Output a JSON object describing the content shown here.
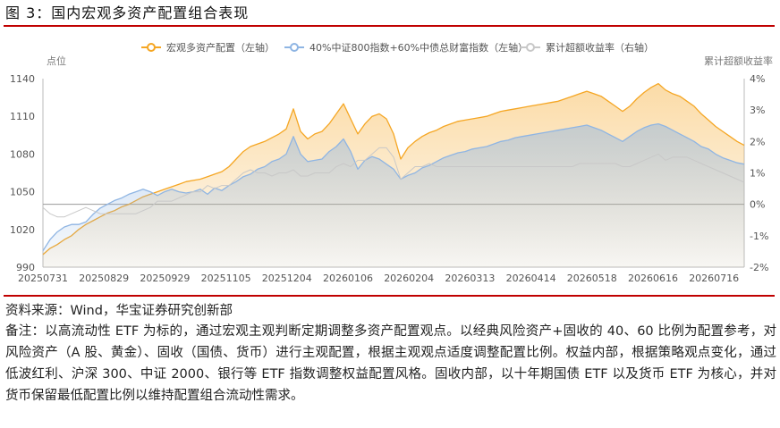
{
  "figure": {
    "title": "图 3：国内宏观多资产配置组合表现",
    "source": "资料来源：Wind，华宝证券研究创新部",
    "note": "备注：以高流动性 ETF 为标的，通过宏观主观判断定期调整多资产配置观点。以经典风险资产+固收的 40、60 比例为配置参考，对风险资产（A 股、黄金）、固收（国债、货币）进行主观配置，根据主观观点适度调整配置比例。权益内部，根据策略观点变化，通过低波红利、沪深 300、中证 2000、银行等 ETF 指数调整权益配置风格。固收内部，以十年期国债 ETF 以及货币 ETF 为核心，并对货币保留最低配置比例以维持配置组合流动性需求。"
  },
  "colors": {
    "macro": "#f5a623",
    "benchmark": "#8fb5e3",
    "excess": "#c8c8c8",
    "rule": "#c00000"
  },
  "chart_data": {
    "type": "line",
    "title": "",
    "ylabel_left": "点位",
    "ylabel_right": "累计超额收益率",
    "ylim_left": [
      990,
      1140
    ],
    "ylim_right": [
      -2,
      4
    ],
    "yticks_left": [
      "990",
      "1020",
      "1050",
      "1080",
      "1110",
      "1140"
    ],
    "yticks_right": [
      "-2%",
      "-1%",
      "0%",
      "1%",
      "2%",
      "3%",
      "4%"
    ],
    "xticks": [
      "20250731",
      "20250829",
      "20250929",
      "20251105",
      "20251204",
      "20260106",
      "20260204",
      "20260313",
      "20260414",
      "20260518",
      "20260616",
      "20260716"
    ],
    "grid": false,
    "legend": "top",
    "series": [
      {
        "name": "宏观多资产配置（左轴）",
        "axis": "left",
        "style": "line-area",
        "values": [
          1000,
          1005,
          1008,
          1012,
          1015,
          1020,
          1024,
          1027,
          1030,
          1033,
          1035,
          1038,
          1040,
          1043,
          1046,
          1048,
          1050,
          1052,
          1054,
          1056,
          1058,
          1059,
          1060,
          1062,
          1064,
          1066,
          1070,
          1076,
          1082,
          1086,
          1088,
          1090,
          1093,
          1096,
          1100,
          1116,
          1098,
          1092,
          1096,
          1098,
          1104,
          1112,
          1120,
          1108,
          1096,
          1104,
          1110,
          1112,
          1108,
          1096,
          1076,
          1085,
          1090,
          1094,
          1097,
          1099,
          1102,
          1104,
          1106,
          1107,
          1108,
          1109,
          1110,
          1112,
          1114,
          1115,
          1116,
          1117,
          1118,
          1119,
          1120,
          1121,
          1122,
          1124,
          1126,
          1128,
          1130,
          1128,
          1126,
          1122,
          1118,
          1114,
          1118,
          1124,
          1129,
          1133,
          1136,
          1131,
          1128,
          1126,
          1122,
          1118,
          1112,
          1107,
          1102,
          1098,
          1094,
          1090,
          1087
        ]
      },
      {
        "name": "40%中证800指数+60%中债总财富指数（左轴）",
        "axis": "left",
        "style": "line-area",
        "values": [
          1003,
          1012,
          1018,
          1022,
          1024,
          1024,
          1026,
          1032,
          1037,
          1040,
          1043,
          1045,
          1048,
          1050,
          1052,
          1050,
          1047,
          1050,
          1052,
          1050,
          1049,
          1050,
          1052,
          1048,
          1053,
          1051,
          1055,
          1058,
          1062,
          1064,
          1068,
          1070,
          1074,
          1076,
          1080,
          1094,
          1080,
          1074,
          1075,
          1076,
          1082,
          1086,
          1092,
          1082,
          1068,
          1075,
          1078,
          1076,
          1072,
          1068,
          1060,
          1063,
          1065,
          1069,
          1071,
          1074,
          1077,
          1079,
          1081,
          1082,
          1084,
          1085,
          1086,
          1088,
          1090,
          1091,
          1093,
          1094,
          1095,
          1096,
          1097,
          1098,
          1099,
          1100,
          1101,
          1102,
          1103,
          1101,
          1099,
          1096,
          1093,
          1090,
          1094,
          1098,
          1101,
          1103,
          1104,
          1102,
          1099,
          1096,
          1093,
          1090,
          1086,
          1084,
          1080,
          1077,
          1075,
          1073,
          1072
        ]
      },
      {
        "name": "累计超额收益率（右轴）",
        "axis": "right",
        "style": "line",
        "values": [
          -0.1,
          -0.3,
          -0.4,
          -0.4,
          -0.3,
          -0.2,
          -0.1,
          -0.2,
          -0.3,
          -0.3,
          -0.3,
          -0.3,
          -0.3,
          -0.3,
          -0.2,
          -0.1,
          0.1,
          0.1,
          0.1,
          0.2,
          0.3,
          0.4,
          0.4,
          0.6,
          0.5,
          0.6,
          0.6,
          0.8,
          1.0,
          1.1,
          1.0,
          1.0,
          0.9,
          1.0,
          1.0,
          1.1,
          0.9,
          0.9,
          1.0,
          1.0,
          1.0,
          1.2,
          1.3,
          1.2,
          1.4,
          1.4,
          1.6,
          1.8,
          1.8,
          1.5,
          0.8,
          1.0,
          1.2,
          1.2,
          1.3,
          1.2,
          1.2,
          1.2,
          1.2,
          1.2,
          1.2,
          1.2,
          1.2,
          1.2,
          1.2,
          1.2,
          1.2,
          1.2,
          1.2,
          1.2,
          1.2,
          1.2,
          1.2,
          1.2,
          1.2,
          1.3,
          1.3,
          1.3,
          1.3,
          1.3,
          1.3,
          1.2,
          1.2,
          1.3,
          1.4,
          1.5,
          1.6,
          1.4,
          1.5,
          1.5,
          1.5,
          1.4,
          1.3,
          1.2,
          1.1,
          1.0,
          0.9,
          0.8,
          0.7
        ]
      }
    ]
  }
}
